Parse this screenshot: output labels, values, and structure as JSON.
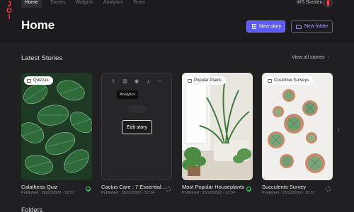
{
  "nav": {
    "tabs": [
      "Home",
      "Stories",
      "Widgets",
      "Analytics",
      "Team"
    ],
    "active": "Home",
    "username": "WS Bastien"
  },
  "header": {
    "title": "Home",
    "new_story_label": "New story",
    "new_folder_label": "New folder"
  },
  "latest": {
    "title": "Latest Stories",
    "view_all_label": "View all stories",
    "arrow": "›",
    "next_arrow": "›"
  },
  "stories": [
    {
      "chip": "Quizzes",
      "title": "Calatheas Quiz",
      "meta": "Published : 26/12/2022 - 12:57",
      "status": "published"
    },
    {
      "chip": "",
      "title": "Cactus Care : 7 Essential...",
      "meta": "Published : 26/12/2022 - 12:34",
      "status": "pending",
      "hover": {
        "tooltip": "Analytics",
        "edit_label": "Edit story"
      }
    },
    {
      "chip": "Popular Plants",
      "title": "Most Popular Houseplants",
      "meta": "Published : 26/12/2022 - 12:34",
      "status": "published"
    },
    {
      "chip": "Customer Surveys",
      "title": "Succulents Survey",
      "meta": "Published : 23/12/2022 - 20:07",
      "status": "pending"
    }
  ],
  "folders": {
    "title": "Folders"
  },
  "colors": {
    "accent": "#ff3b4e",
    "primary": "#5b5cf5",
    "success": "#3fcf6a"
  }
}
